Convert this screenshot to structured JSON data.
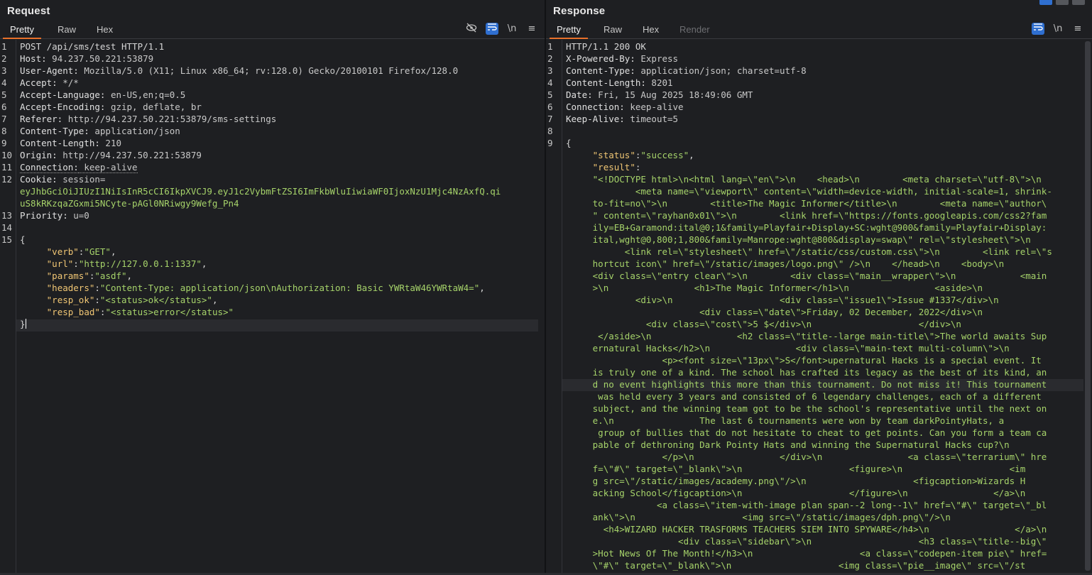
{
  "request": {
    "title": "Request",
    "tabs": [
      "Pretty",
      "Raw",
      "Hex"
    ],
    "active_tab": "Pretty",
    "tool_icons": [
      "hide-icon",
      "wrap-icon",
      "newline-icon",
      "menu-icon"
    ],
    "newline_label": "\\n",
    "lines": [
      {
        "n": "1",
        "text": "POST /api/sms/test HTTP/1.1"
      },
      {
        "n": "2",
        "name": "Host:",
        "value": " 94.237.50.221:53879"
      },
      {
        "n": "3",
        "name": "User-Agent:",
        "value": " Mozilla/5.0 (X11; Linux x86_64; rv:128.0) Gecko/20100101 Firefox/128.0"
      },
      {
        "n": "4",
        "name": "Accept:",
        "value": " */*"
      },
      {
        "n": "5",
        "name": "Accept-Language:",
        "value": " en-US,en;q=0.5"
      },
      {
        "n": "6",
        "name": "Accept-Encoding:",
        "value": " gzip, deflate, br"
      },
      {
        "n": "7",
        "name": "Referer:",
        "value": " http://94.237.50.221:53879/sms-settings"
      },
      {
        "n": "8",
        "name": "Content-Type:",
        "value": " application/json"
      },
      {
        "n": "9",
        "name": "Content-Length:",
        "value": " 210"
      },
      {
        "n": "10",
        "name": "Origin:",
        "value": " http://94.237.50.221:53879"
      },
      {
        "n": "11",
        "name": "Connection:",
        "value": " keep-alive"
      },
      {
        "n": "12",
        "name": "Cookie:",
        "value": " session="
      },
      {
        "n": "",
        "cookie": "eyJhbGciOiJIUzI1NiIsInR5cCI6IkpXVCJ9.eyJ1c2VybmFtZSI6ImFkbWluIiwiaWF0IjoxNzU1Mjc4NzAxfQ.qi"
      },
      {
        "n": "",
        "cookie": "uS8kRKzqaZGxmi5NCyte-pAGl0NRiwgy9Wefg_Pn4"
      },
      {
        "n": "13",
        "name": "Priority:",
        "value": " u=0"
      },
      {
        "n": "14",
        "text": ""
      },
      {
        "n": "15",
        "text": "{"
      }
    ],
    "body": [
      {
        "key": "\"verb\"",
        "val": "\"GET\"",
        "end": ","
      },
      {
        "key": "\"url\"",
        "val": "\"http://127.0.0.1:1337\"",
        "end": ","
      },
      {
        "key": "\"params\"",
        "val": "\"asdf\"",
        "end": ","
      },
      {
        "key": "\"headers\"",
        "val": "\"Content-Type: application/json\\nAuthorization: Basic YWRtaW46YWRtaW4=\"",
        "end": ","
      },
      {
        "key": "\"resp_ok\"",
        "val": "\"<status>ok</status>\"",
        "end": ","
      },
      {
        "key": "\"resp_bad\"",
        "val": "\"<status>error</status>\"",
        "end": ""
      }
    ],
    "closing": "}"
  },
  "response": {
    "title": "Response",
    "tabs": [
      "Pretty",
      "Raw",
      "Hex",
      "Render"
    ],
    "active_tab": "Pretty",
    "tool_icons": [
      "wrap-icon",
      "newline-icon",
      "menu-icon"
    ],
    "newline_label": "\\n",
    "headers": [
      {
        "n": "1",
        "text": "HTTP/1.1 200 OK"
      },
      {
        "n": "2",
        "name": "X-Powered-By:",
        "value": " Express"
      },
      {
        "n": "3",
        "name": "Content-Type:",
        "value": " application/json; charset=utf-8"
      },
      {
        "n": "4",
        "name": "Content-Length:",
        "value": " 8201"
      },
      {
        "n": "5",
        "name": "Date:",
        "value": " Fri, 15 Aug 2025 18:49:06 GMT"
      },
      {
        "n": "6",
        "name": "Connection:",
        "value": " keep-alive"
      },
      {
        "n": "7",
        "name": "Keep-Alive:",
        "value": " timeout=5"
      },
      {
        "n": "8",
        "text": ""
      },
      {
        "n": "9",
        "text": "{"
      }
    ],
    "status_key": "\"status\"",
    "status_val": "\"success\"",
    "result_key": "\"result\"",
    "result_lines": [
      "\"<!DOCTYPE html>\\n<html lang=\\\"en\\\">\\n    <head>\\n        <meta charset=\\\"utf-8\\\">\\n",
      "        <meta name=\\\"viewport\\\" content=\\\"width=device-width, initial-scale=1, shrink-",
      "to-fit=no\\\">\\n        <title>The Magic Informer</title>\\n        <meta name=\\\"author\\",
      "\" content=\\\"rayhan0x01\\\">\\n        <link href=\\\"https://fonts.googleapis.com/css2?fam",
      "ily=EB+Garamond:ital@0;1&family=Playfair+Display+SC:wght@900&family=Playfair+Display:",
      "ital,wght@0,800;1,800&family=Manrope:wght@800&display=swap\\\" rel=\\\"stylesheet\\\">\\n",
      "      <link rel=\\\"stylesheet\\\" href=\\\"/static/css/custom.css\\\">\\n        <link rel=\\\"s",
      "hortcut icon\\\" href=\\\"/static/images/logo.png\\\" />\\n    </head>\\n    <body>\\n",
      "<div class=\\\"entry clear\\\">\\n        <div class=\\\"main__wrapper\\\">\\n            <main",
      ">\\n                <h1>The Magic Informer</h1>\\n                <aside>\\n",
      "        <div>\\n                    <div class=\\\"issue1\\\">Issue #1337</div>\\n",
      "                    <div class=\\\"date\\\">Friday, 02 December, 2022</div>\\n",
      "          <div class=\\\"cost\\\">5 $</div>\\n                    </div>\\n",
      " </aside>\\n                <h2 class=\\\"title--large main-title\\\">The world awaits Sup",
      "ernatural Hacks</h2>\\n                <div class=\\\"main-text multi-column\\\">\\n",
      "             <p><font size=\\\"13px\\\">S</font>upernatural Hacks is a special event. It",
      "is truly one of a kind. The school has crafted its legacy as the best of its kind, an",
      "d no event highlights this more than this tournament. Do not miss it! This tournament",
      " was held every 3 years and consisted of 6 legendary challenges, each of a different",
      "subject, and the winning team got to be the school's representative until the next on",
      "e.\\n                The last 6 tournaments were won by team darkPointyHats, a",
      " group of bullies that do not hesitate to cheat to get points. Can you form a team ca",
      "pable of dethroning Dark Pointy Hats and winning the Supernatural Hacks cup?\\n",
      "             </p>\\n                </div>\\n                <a class=\\\"terrarium\\\" hre",
      "f=\\\"#\\\" target=\\\"_blank\\\">\\n                    <figure>\\n                    <im",
      "g src=\\\"/static/images/academy.png\\\"/>\\n                    <figcaption>Wizards H",
      "acking School</figcaption>\\n                    </figure>\\n                </a>\\n",
      "            <a class=\\\"item-with-image plan span--2 long--1\\\" href=\\\"#\\\" target=\\\"_bl",
      "ank\\\">\\n                    <img src=\\\"/static/images/dph.png\\\"/>\\n",
      "  <h4>WIZARD HACKER TRASFORMS TEACHERS SIEM INTO SPYWARE</h4>\\n                </a>\\n",
      "                <div class=\\\"sidebar\\\">\\n                    <h3 class=\\\"title--big\\\"",
      ">Hot News Of The Month!</h3>\\n                    <a class=\\\"codepen-item pie\\\" href=",
      "\\\"#\\\" target=\\\"_blank\\\">\\n                    <img class=\\\"pie__image\\\" src=\\\"/st"
    ]
  }
}
